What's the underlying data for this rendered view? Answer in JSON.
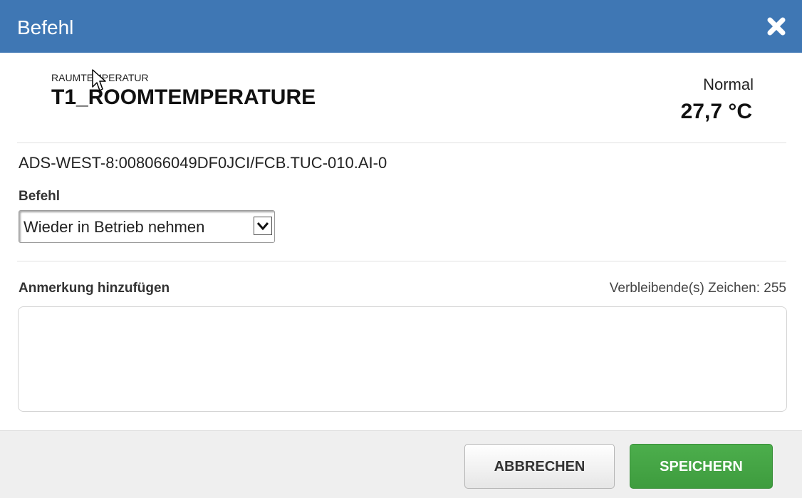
{
  "dialog": {
    "title": "Befehl",
    "close_icon": "close-icon"
  },
  "point": {
    "subtitle": "RAUMTEMPERATUR",
    "name": "T1_ROOMTEMPERATURE",
    "status": "Normal",
    "value": "27,7 °C",
    "address": "ADS-WEST-8:008066049DF0JCI/FCB.TUC-010.AI-0"
  },
  "command": {
    "label": "Befehl",
    "selected": "Wieder in Betrieb nehmen",
    "arrow_icon": "chevron-down-icon"
  },
  "annotation": {
    "label": "Anmerkung hinzufügen",
    "remaining": "Verbleibende(s) Zeichen: 255",
    "value": ""
  },
  "footer": {
    "cancel_label": "ABBRECHEN",
    "save_label": "SPEICHERN"
  },
  "colors": {
    "titlebar": "#3f77b4",
    "save_button": "#46a546",
    "footer_bg": "#efefef"
  }
}
